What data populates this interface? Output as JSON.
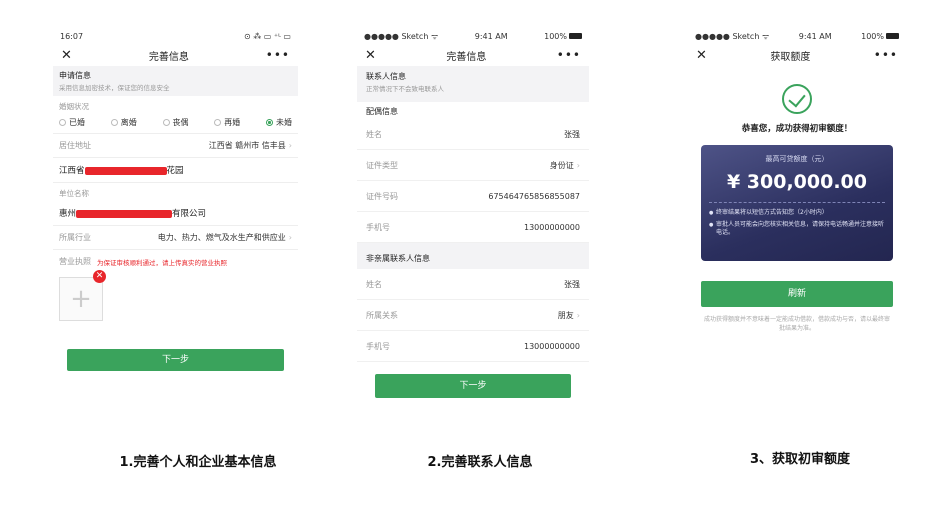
{
  "screen1": {
    "status_time": "16:07",
    "status_icons": "⊙ ⁂ ▭ ⁺ᴸ ▭",
    "nav_title": "完善信息",
    "section_title": "申请信息",
    "section_sub": "采用信息加密技术，保证您的信息安全",
    "marital_label": "婚姻状况",
    "marital_options": [
      "已婚",
      "离婚",
      "丧偶",
      "再婚",
      "未婚"
    ],
    "address_label": "居住地址",
    "address_value": "江西省 赣州市 信丰县",
    "address_detail_start": "江西省",
    "address_detail_end": "花园",
    "company_label": "单位名称",
    "company_start": "惠州",
    "company_end": "有限公司",
    "industry_label": "所属行业",
    "industry_value": "电力、热力、燃气及水生产和供应业",
    "license_label": "营业执照",
    "license_hint": "为保证审核顺利通过，请上传真实的营业执照",
    "next_button": "下一步"
  },
  "screen2": {
    "status_carrier": "●●●●● Sketch ᯤ",
    "status_time": "9:41 AM",
    "status_battery": "100%",
    "nav_title": "完善信息",
    "contact_title": "联系人信息",
    "contact_sub": "正常情况下不会致电联系人",
    "spouse_title": "配偶信息",
    "spouse_rows": [
      {
        "label": "姓名",
        "value": "张强",
        "chevron": false
      },
      {
        "label": "证件类型",
        "value": "身份证",
        "chevron": true
      },
      {
        "label": "证件号码",
        "value": "675464765856855087",
        "chevron": false
      },
      {
        "label": "手机号",
        "value": "13000000000",
        "chevron": false
      }
    ],
    "nonrelative_title": "非亲属联系人信息",
    "nonrelative_rows": [
      {
        "label": "姓名",
        "value": "张强",
        "chevron": false
      },
      {
        "label": "所属关系",
        "value": "朋友",
        "chevron": true
      },
      {
        "label": "手机号",
        "value": "13000000000",
        "chevron": false
      }
    ],
    "next_button": "下一步"
  },
  "screen3": {
    "status_carrier": "●●●●● Sketch ᯤ",
    "status_time": "9:41 AM",
    "status_battery": "100%",
    "nav_title": "获取额度",
    "congrats": "恭喜您，成功获得初审额度！",
    "card_caption": "最高可贷额度（元）",
    "amount": "¥ 300,000.00",
    "notes": [
      "终审结果将以短信方式告知您（2小时内）",
      "审批人员可能会向您核实相关信息，请保持电话畅通并注意接听电话。"
    ],
    "refresh_button": "刷新",
    "disclaimer": "成功获得额度并不意味着一定能成功借款，借款成功与否，请以最终审批结果为准。"
  },
  "captions": [
    "1.完善个人和企业基本信息",
    "2.完善联系人信息",
    "3、获取初审额度"
  ],
  "colors": {
    "accent": "#3aa35c",
    "card": "#2b2f5e",
    "redact": "#e8262b"
  }
}
